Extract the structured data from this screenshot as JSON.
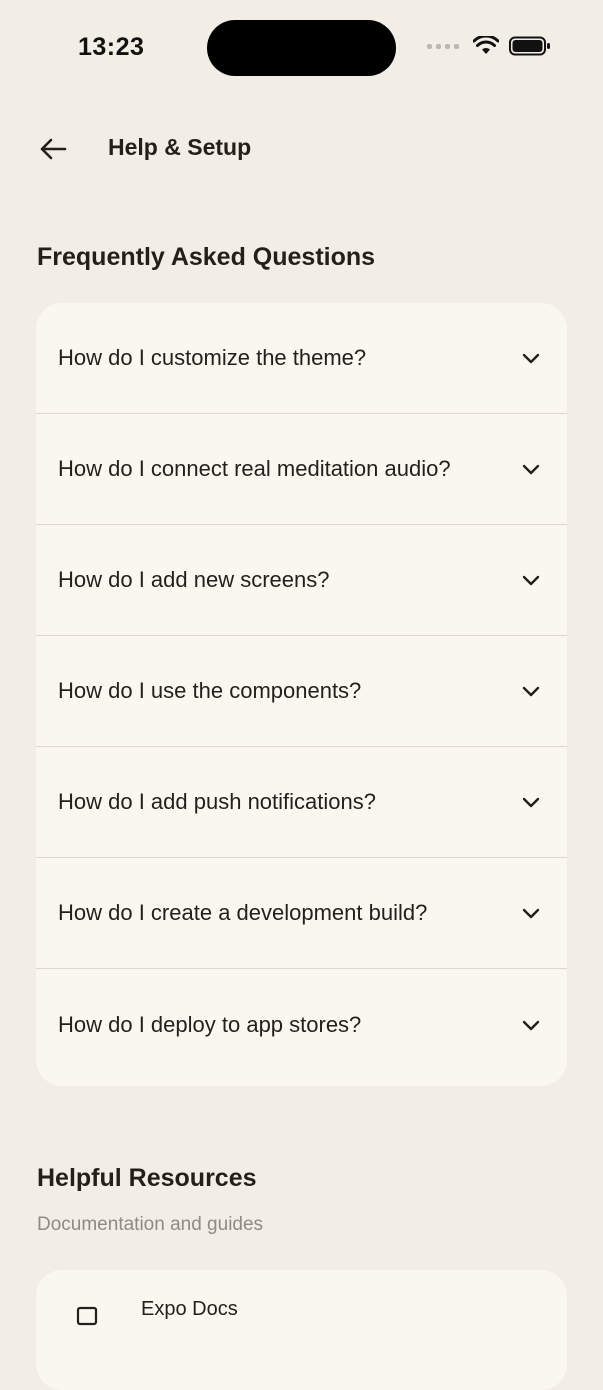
{
  "status_bar": {
    "time": "13:23"
  },
  "header": {
    "back_icon": "arrow-left-icon",
    "title": "Help & Setup"
  },
  "faq": {
    "title": "Frequently Asked Questions",
    "items": [
      {
        "question": "How do I customize the theme?",
        "icon": "chevron-down-icon"
      },
      {
        "question": "How do I connect real meditation audio?",
        "icon": "chevron-down-icon"
      },
      {
        "question": "How do I add new screens?",
        "icon": "chevron-down-icon"
      },
      {
        "question": "How do I use the components?",
        "icon": "chevron-down-icon"
      },
      {
        "question": "How do I add push notifications?",
        "icon": "chevron-down-icon"
      },
      {
        "question": "How do I create a development build?",
        "icon": "chevron-down-icon"
      },
      {
        "question": "How do I deploy to app stores?",
        "icon": "chevron-down-icon"
      }
    ]
  },
  "resources": {
    "title": "Helpful Resources",
    "subtitle": "Documentation and guides",
    "items": [
      {
        "name": "Expo Docs",
        "icon": "book-icon"
      }
    ]
  },
  "colors": {
    "background": "#f2eee6",
    "card": "#faf7f1",
    "text": "#231f1a",
    "muted": "#8f8a82",
    "divider": "#dcd6cc"
  }
}
